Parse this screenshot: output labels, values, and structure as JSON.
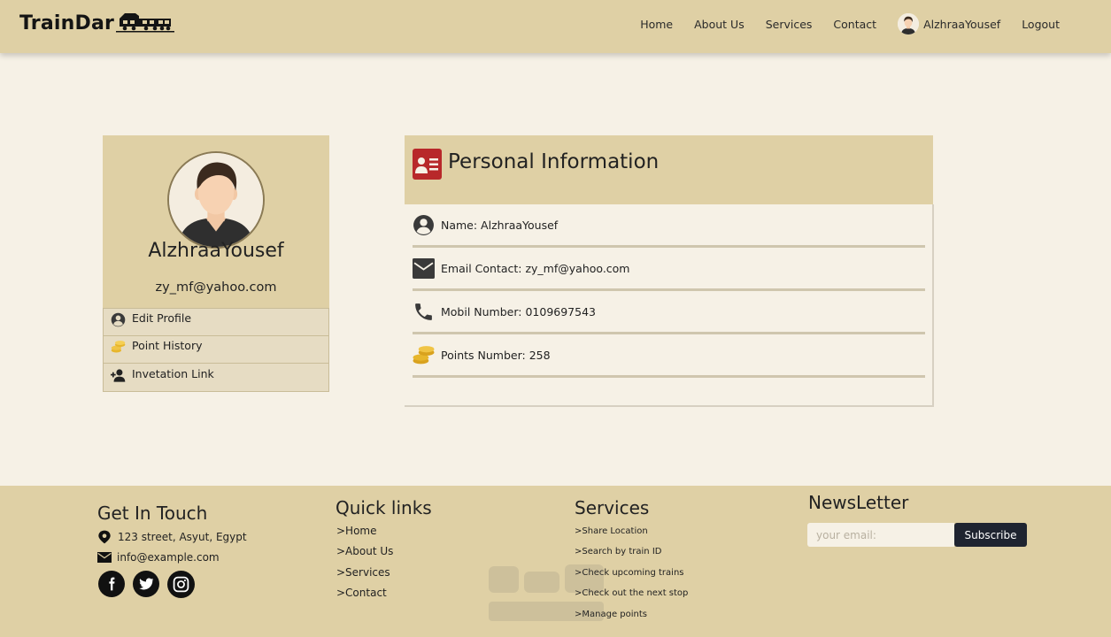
{
  "navbar": {
    "brand": "TrainDar",
    "links": [
      "Home",
      "About Us",
      "Services",
      "Contact"
    ],
    "username": "AlzhraaYousef",
    "logout": "Logout"
  },
  "profile": {
    "name": "AlzhraaYousef",
    "email": "zy_mf@yahoo.com",
    "menu": [
      {
        "label": "Edit Profile",
        "icon": "user-circle-icon"
      },
      {
        "label": "Point History",
        "icon": "coins-icon"
      },
      {
        "label": "Invetation Link",
        "icon": "user-plus-icon"
      }
    ]
  },
  "info": {
    "title": "Personal Information",
    "rows": [
      {
        "text": "Name: AlzhraaYousef",
        "icon": "user-circle-icon"
      },
      {
        "text": "Email Contact: zy_mf@yahoo.com",
        "icon": "envelope-icon"
      },
      {
        "text": "Mobil Number: 0109697543",
        "icon": "phone-icon"
      },
      {
        "text": "Points Number: 258",
        "icon": "coins-icon"
      }
    ]
  },
  "footer": {
    "contact": {
      "heading": "Get In Touch",
      "address": "123 street, Asyut, Egypt",
      "email": "info@example.com"
    },
    "quick_links": {
      "heading": "Quick links",
      "items": [
        ">Home",
        ">About Us",
        ">Services",
        ">Contact"
      ]
    },
    "services": {
      "heading": "Services",
      "items": [
        ">Share Location",
        ">Search by train ID",
        ">Check upcoming trains",
        ">Check out the next stop",
        ">Manage points"
      ]
    },
    "newsletter": {
      "heading": "NewsLetter",
      "placeholder": "your email:",
      "button": "Subscribe"
    }
  },
  "colors": {
    "accent": "#dfd0a5",
    "background": "#f6f1e6",
    "button_dark": "#1f2430",
    "id_card_red": "#b8282a",
    "coin_gold": "#e7b62c"
  }
}
